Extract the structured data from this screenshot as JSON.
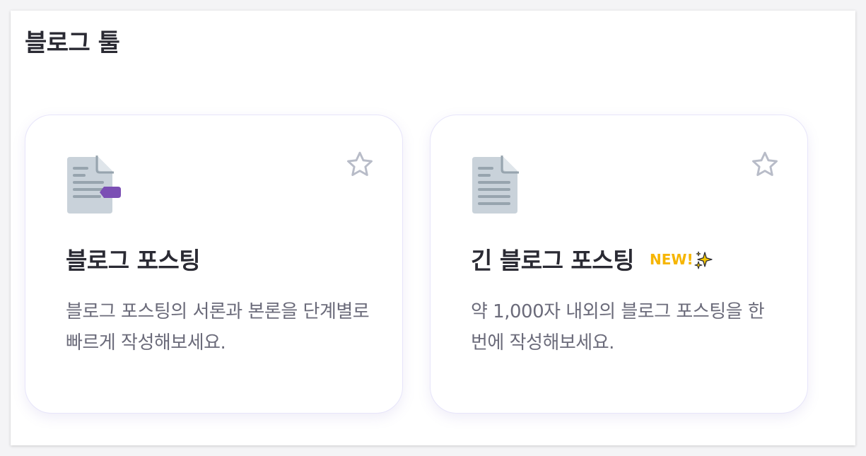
{
  "section": {
    "title": "블로그 툴"
  },
  "cards": [
    {
      "icon": "document-tag-icon",
      "title": "블로그 포스팅",
      "description": "블로그 포스팅의 서론과 본론을 단계별로 빠르게 작성해보세요.",
      "favorite": false
    },
    {
      "icon": "document-icon",
      "title": "긴 블로그 포스팅",
      "badge": "NEW!",
      "badge_icon": "sparkle-icon",
      "description": "약 1,000자 내외의 블로그 포스팅을 한 번에 작성해보세요.",
      "favorite": false
    }
  ],
  "colors": {
    "accent_purple": "#7b4fb4",
    "badge_yellow": "#f6b500",
    "doc_gray": "#c9d2da",
    "star_outline": "#b8bcc8"
  }
}
